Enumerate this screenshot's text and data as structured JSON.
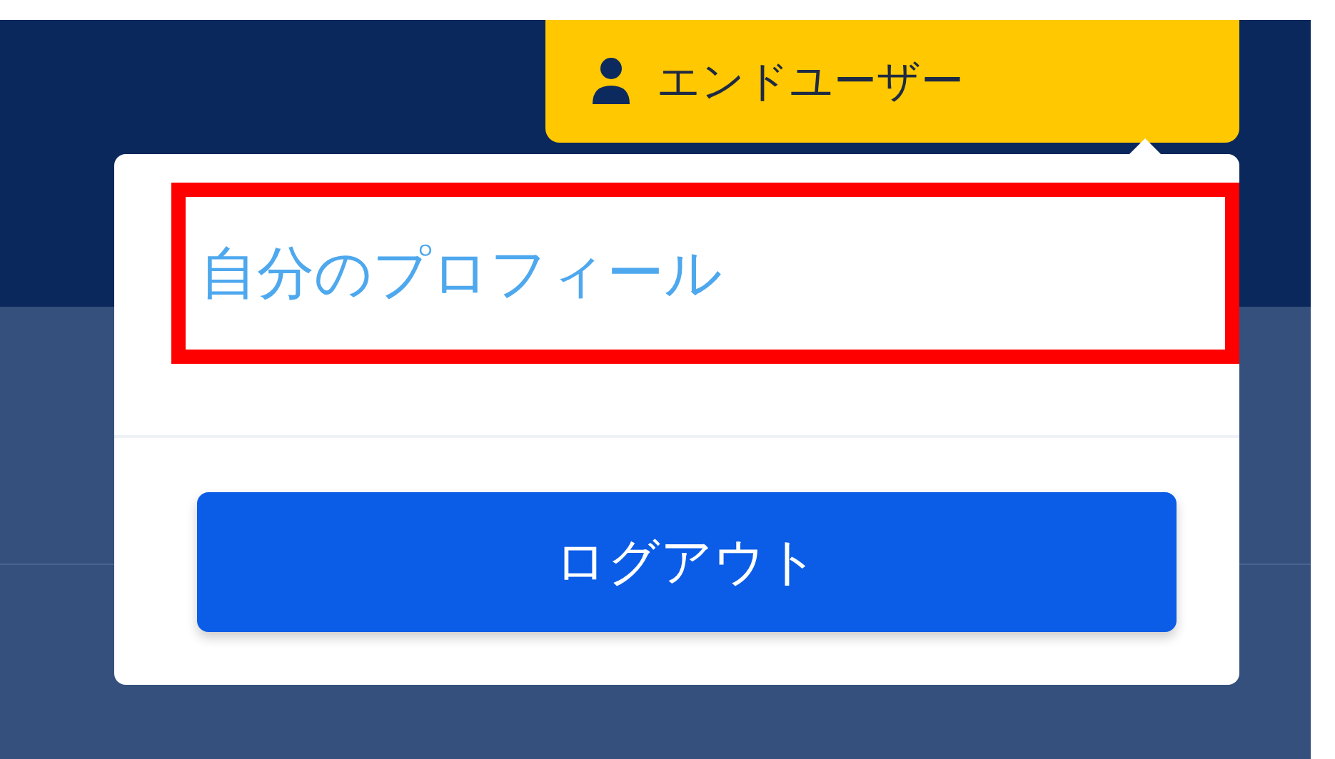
{
  "user_button": {
    "label": "エンドユーザー"
  },
  "dropdown": {
    "items": [
      {
        "kind": "link",
        "label": "自分のプロフィール",
        "highlighted": true
      },
      {
        "kind": "button",
        "label": "ログアウト",
        "highlighted": false
      }
    ]
  }
}
